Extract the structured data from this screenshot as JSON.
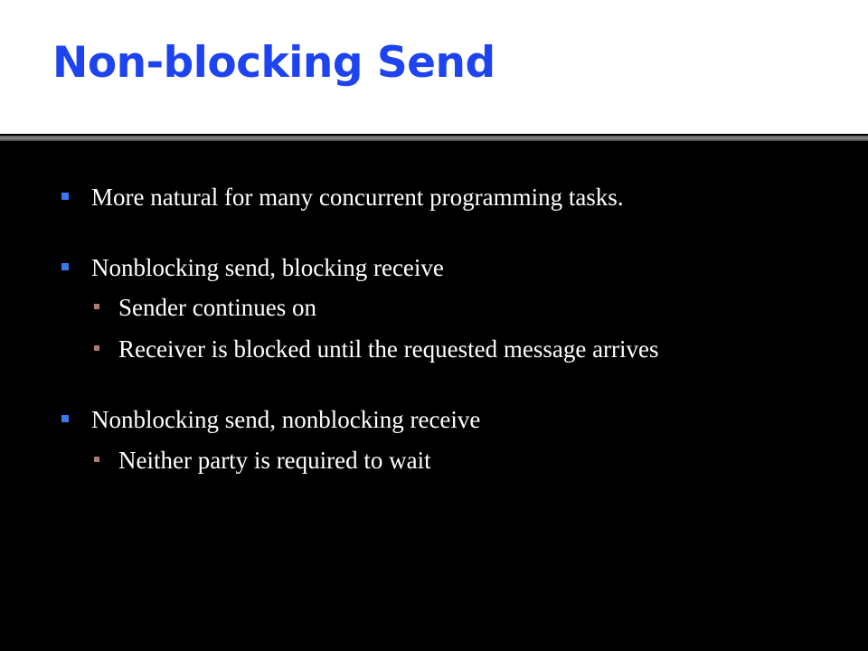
{
  "slide": {
    "title": "Non-blocking Send",
    "bullets": [
      {
        "text": "More natural for many concurrent programming tasks."
      },
      {
        "text": "Nonblocking send, blocking receive",
        "sub": [
          {
            "text": "Sender continues on"
          },
          {
            "text": "Receiver is blocked until the requested message arrives"
          }
        ]
      },
      {
        "text": "Nonblocking send, nonblocking receive",
        "sub": [
          {
            "text": "Neither party is required to wait"
          }
        ]
      }
    ]
  },
  "colors": {
    "background": "#000000",
    "title_band": "#ffffff",
    "title_text": "#1d44f0",
    "body_text": "#ffffff",
    "level1_bullet": "#3a78f0",
    "level2_bullet": "#b07a74"
  }
}
